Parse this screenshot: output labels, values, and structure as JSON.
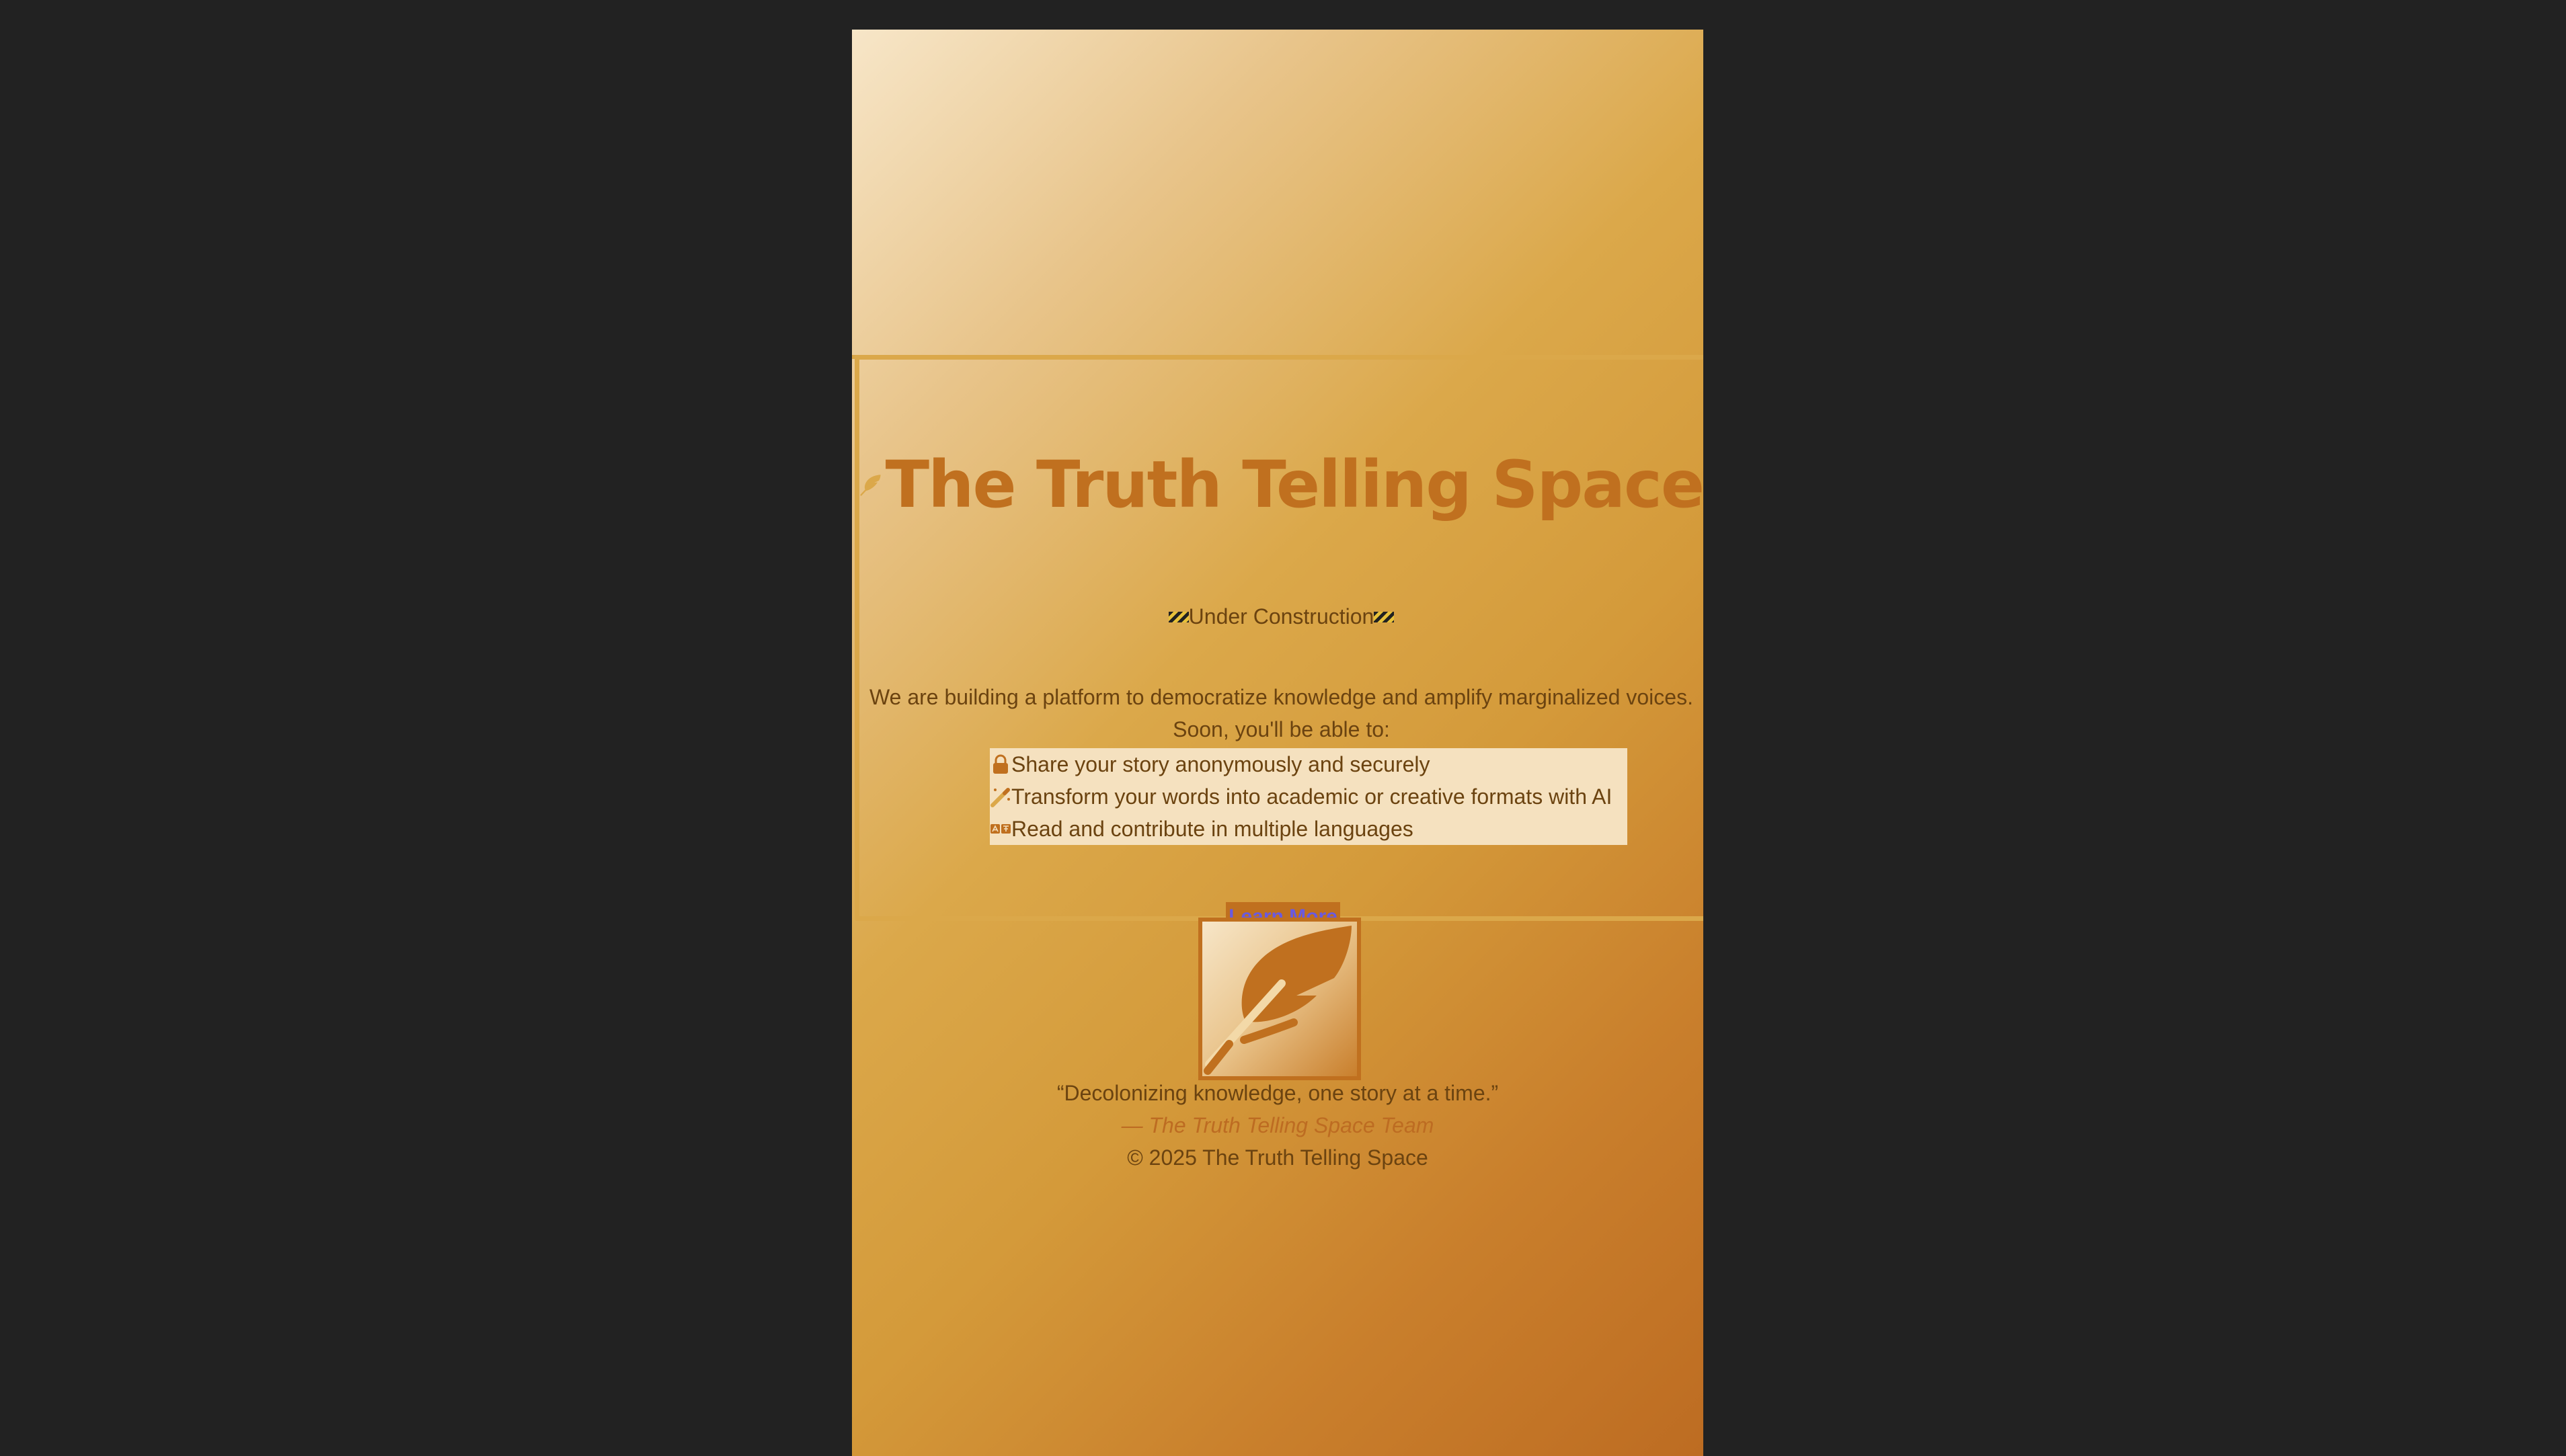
{
  "header": {
    "title": "The Truth Telling Space",
    "title_icon": "feather-icon"
  },
  "status": {
    "label": "Under Construction",
    "icon": "construction-icon"
  },
  "intro": {
    "line1": "We are building a platform to democratize knowledge and amplify marginalized voices.",
    "line2": "Soon, you'll be able to:"
  },
  "features": [
    {
      "icon": "lock-icon",
      "text": "Share your story anonymously and securely"
    },
    {
      "icon": "magic-wand-icon",
      "text": "Transform your words into academic or creative formats with AI"
    },
    {
      "icon": "language-icon",
      "text": "Read and contribute in multiple languages"
    }
  ],
  "cta": {
    "label": "Learn More"
  },
  "logo": {
    "icon": "feather-logo-icon"
  },
  "footer": {
    "quote": "“Decolonizing knowledge, one story at a time.”",
    "attribution": "— The Truth Telling Space Team",
    "copyright": "© 2025 The Truth Telling Space"
  },
  "colors": {
    "page_bg": "#222222",
    "accent": "#c0701f",
    "gold": "#dba84a",
    "text": "#6b4310",
    "feature_bg": "#f5e1bf",
    "link": "#6a5ae0"
  }
}
